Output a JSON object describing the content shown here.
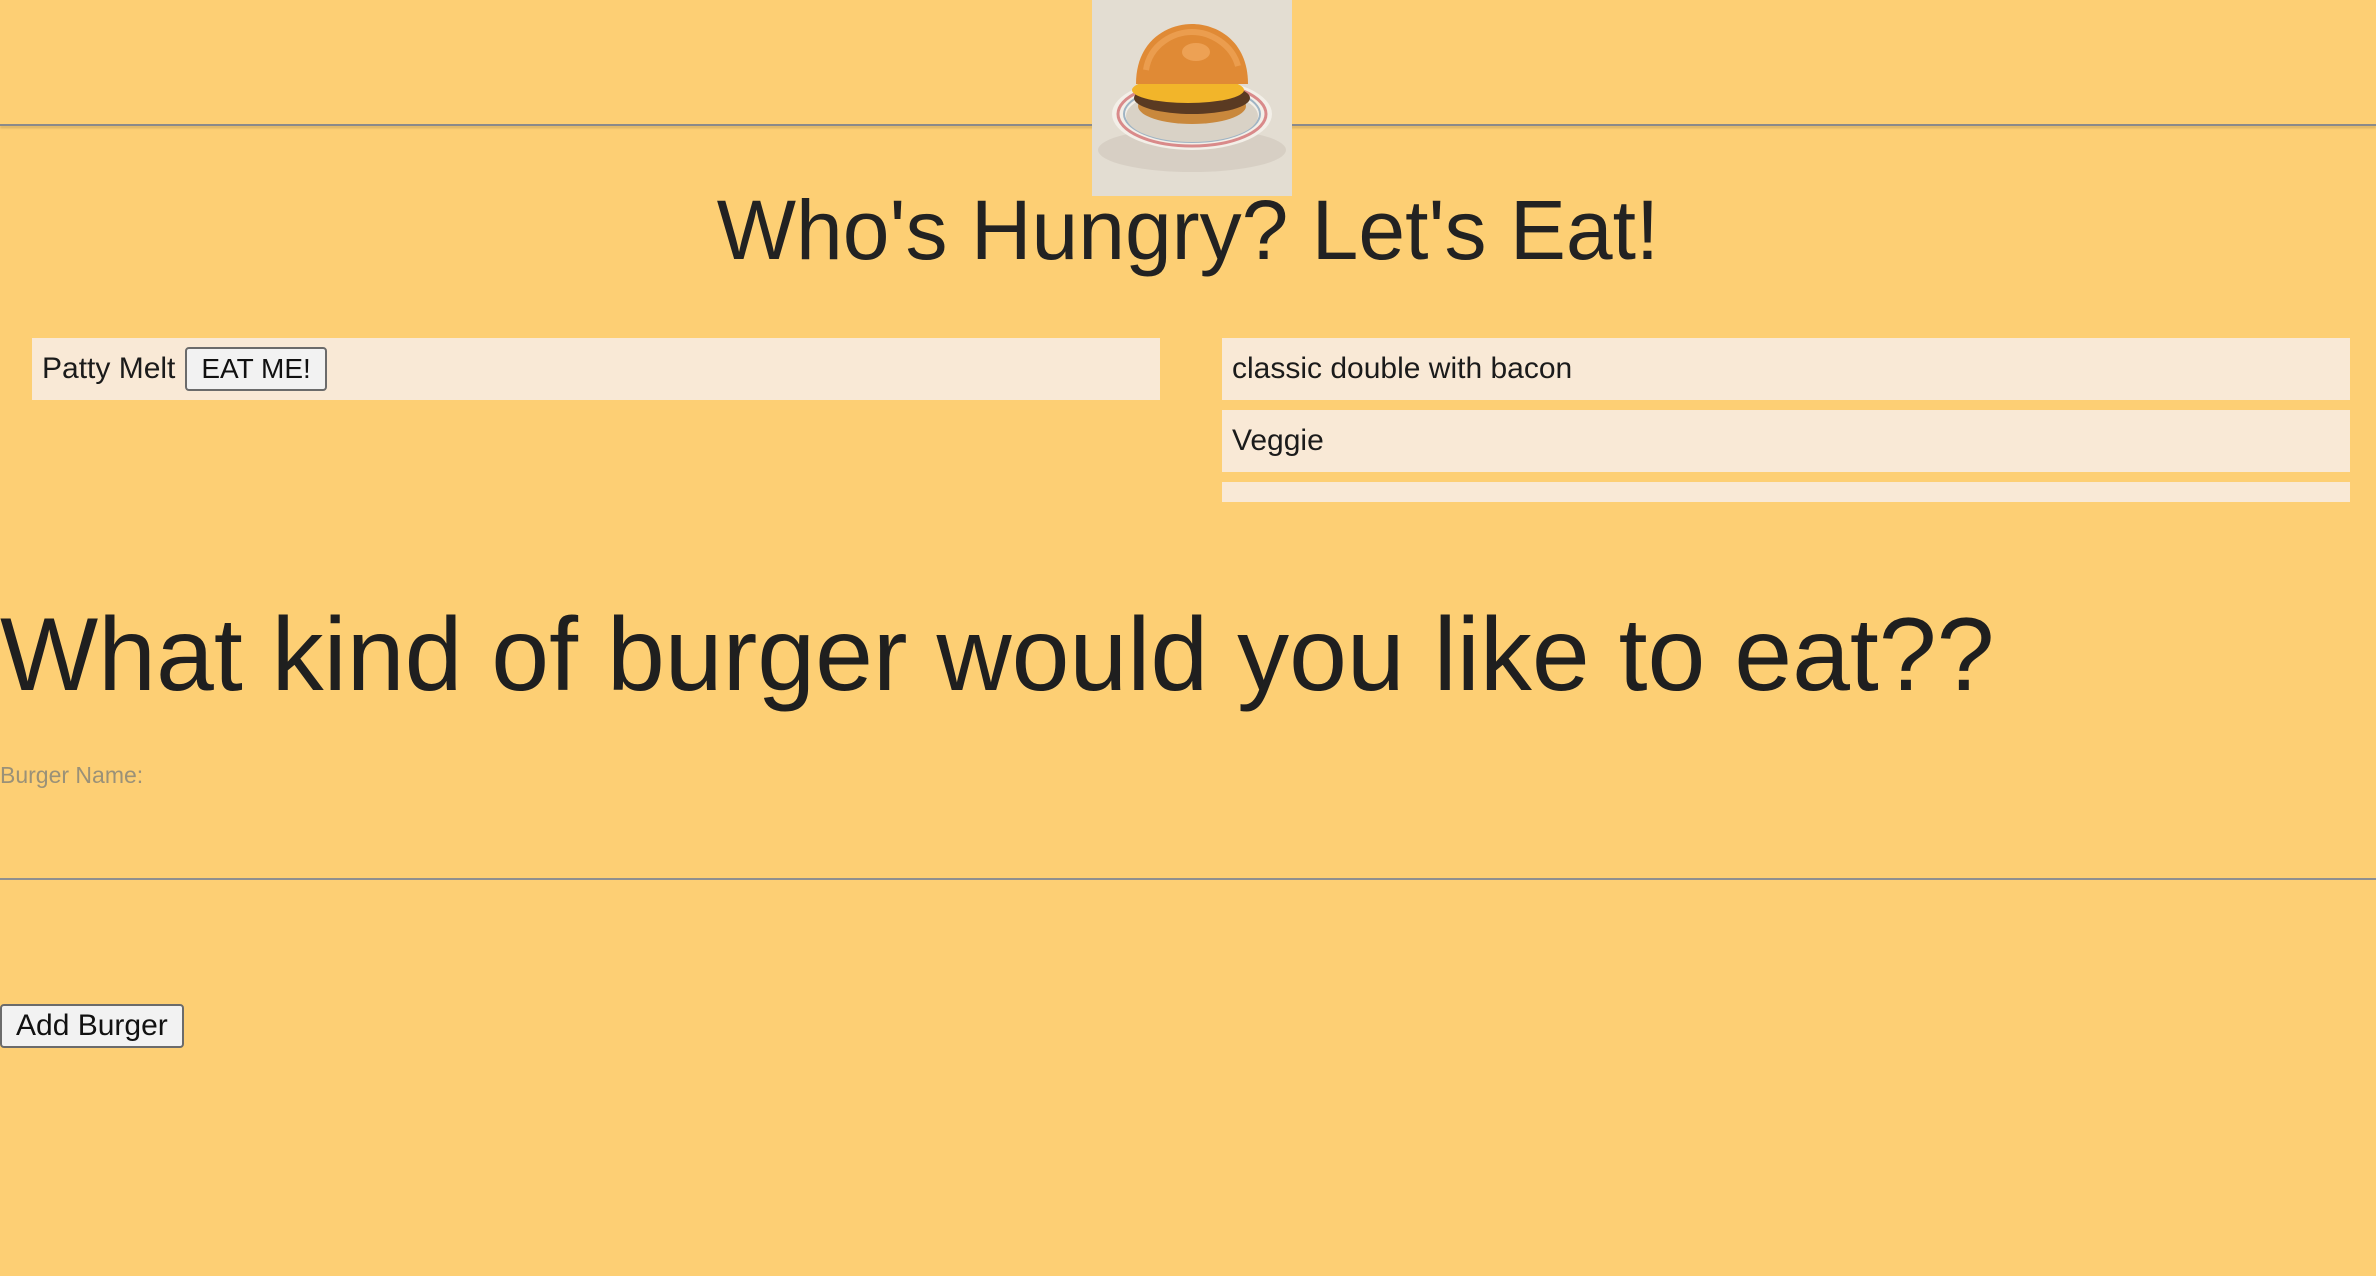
{
  "header": {
    "image_alt": "burger"
  },
  "page_title": "Who's Hungry? Let's Eat!",
  "uneaten_burgers": [
    {
      "name": "Patty Melt",
      "button_label": "EAT ME!"
    }
  ],
  "eaten_burgers": [
    {
      "name": "classic double with bacon"
    },
    {
      "name": "Veggie"
    },
    {
      "name": ""
    }
  ],
  "form": {
    "heading": "What kind of burger would you like to eat??",
    "field_label": "Burger Name:",
    "field_value": "",
    "submit_label": "Add Burger"
  },
  "colors": {
    "background": "#fdcf74",
    "list_item_background": "#f9e9d6"
  }
}
